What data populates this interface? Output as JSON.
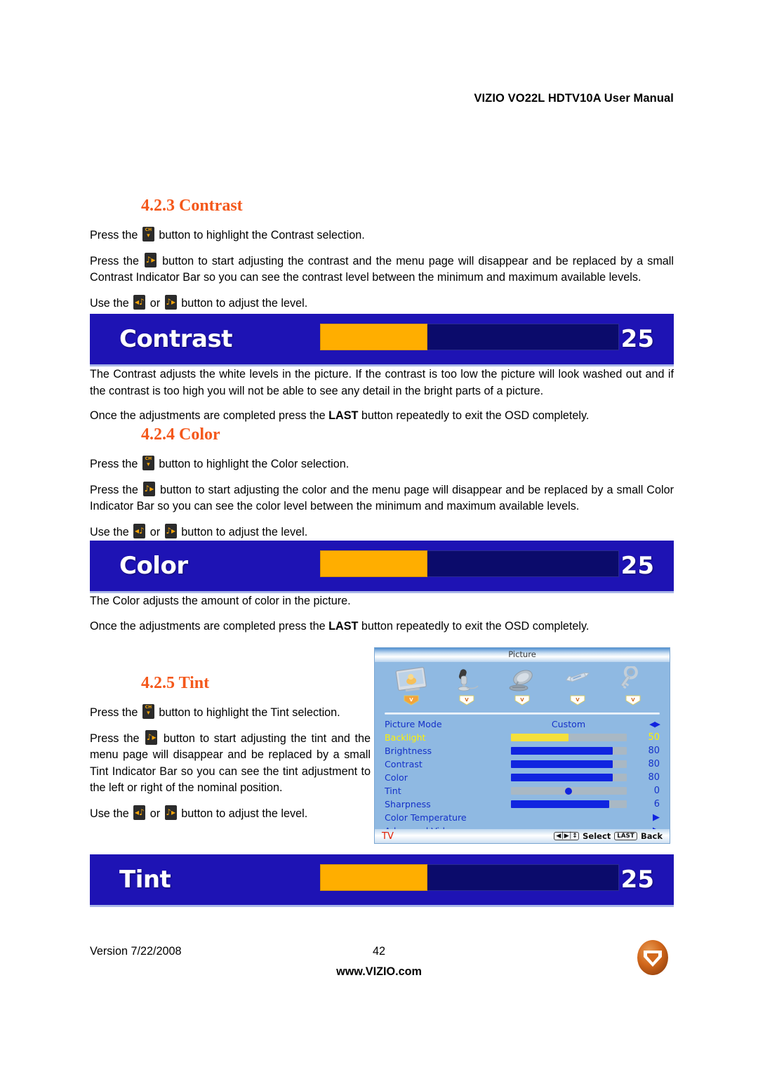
{
  "header": {
    "title": "VIZIO VO22L HDTV10A User Manual"
  },
  "sections": {
    "contrast": {
      "heading": "4.2.3 Contrast",
      "p1_a": "Press the",
      "p1_b": "button to highlight the Contrast selection.",
      "p2_a": "Press the",
      "p2_b": "button to start adjusting the contrast and the menu page will disappear and be replaced by a small Contrast Indicator Bar so you can see the contrast level between the minimum and maximum available levels.",
      "p3_a": "Use the",
      "p3_or": "or",
      "p3_b": "button to adjust the level.",
      "desc": "The Contrast adjusts the white levels in the picture.  If the contrast is too low the picture will look washed out and if the contrast is too high you will not be able to see any detail in the bright parts of a picture.",
      "note_a": "Once the adjustments are completed press the",
      "note_key": "LAST",
      "note_b": "button repeatedly to exit the OSD completely."
    },
    "color": {
      "heading": "4.2.4 Color",
      "p1_a": "Press the",
      "p1_b": "button to highlight the Color selection.",
      "p2_a": "Press the",
      "p2_b": "button to start adjusting the color and the menu page will disappear and be replaced by a small Color Indicator Bar so you can see the color level between the minimum and maximum available levels.",
      "p3_a": "Use the",
      "p3_or": "or",
      "p3_b": "button to adjust the level.",
      "desc": "The Color adjusts the amount of color in the picture.",
      "note_a": "Once the adjustments are completed press the",
      "note_key": "LAST",
      "note_b": "button repeatedly to exit the OSD completely."
    },
    "tint": {
      "heading": "4.2.5 Tint",
      "p1_a": "Press the",
      "p1_b": "button to highlight the Tint selection.",
      "p2_a": "Press the",
      "p2_b": "button to start adjusting the tint and the menu page will disappear and be replaced by a small Tint Indicator Bar so you can see the tint adjustment to the left or right of the nominal position.",
      "p3_a": "Use the",
      "p3_or": "or",
      "p3_b": "button to adjust the level."
    }
  },
  "indicator_bars": [
    {
      "name": "Contrast",
      "value": "25",
      "fill_percent": 36
    },
    {
      "name": "Color",
      "value": "25",
      "fill_percent": 36
    },
    {
      "name": "Tint",
      "value": "25",
      "fill_percent": 36
    }
  ],
  "osd_menu": {
    "title": "Picture",
    "icons": [
      {
        "name": "picture-icon",
        "label": "Picture"
      },
      {
        "name": "microphone-audio-icon",
        "label": "Audio"
      },
      {
        "name": "satellite-tuner-icon",
        "label": "Tuner"
      },
      {
        "name": "wrench-setup-icon",
        "label": "Setup"
      },
      {
        "name": "key-parental-icon",
        "label": "Parental"
      }
    ],
    "rows": [
      {
        "label": "Picture Mode",
        "kind": "value",
        "value": "Custom",
        "control": "left-right-arrows",
        "highlight": false
      },
      {
        "label": "Backlight",
        "kind": "slider",
        "value": "50",
        "fill_percent": 50,
        "highlight": true
      },
      {
        "label": "Brightness",
        "kind": "slider",
        "value": "80",
        "fill_percent": 88,
        "highlight": false
      },
      {
        "label": "Contrast",
        "kind": "slider",
        "value": "80",
        "fill_percent": 88,
        "highlight": false
      },
      {
        "label": "Color",
        "kind": "slider",
        "value": "80",
        "fill_percent": 88,
        "highlight": false
      },
      {
        "label": "Tint",
        "kind": "knob",
        "value": "0",
        "fill_percent": 50,
        "highlight": false
      },
      {
        "label": "Sharpness",
        "kind": "slider",
        "value": "6",
        "fill_percent": 85,
        "highlight": false
      },
      {
        "label": "Color Temperature",
        "kind": "submenu",
        "value": "",
        "highlight": false
      },
      {
        "label": "Advanced Video",
        "kind": "submenu",
        "value": "",
        "highlight": false
      }
    ],
    "footer": {
      "source": "TV",
      "nav_keycap": "◀│▶│↕",
      "select_label": "Select",
      "last_keycap": "LAST",
      "back_label": "Back"
    }
  },
  "footer": {
    "version": "Version 7/22/2008",
    "page_number": "42",
    "website": "www.VIZIO.com"
  },
  "colors": {
    "heading_orange": "#F4581B",
    "osd_bar_blue": "#1E13B4",
    "osd_bar_fill": "#FFAE00",
    "menu_bg": "#8FB9E2",
    "menu_text_blue": "#1531C8",
    "menu_highlight_yellow": "#FFF200",
    "menu_tv_red": "#E01B00",
    "logo_orange": "#D2681C"
  }
}
